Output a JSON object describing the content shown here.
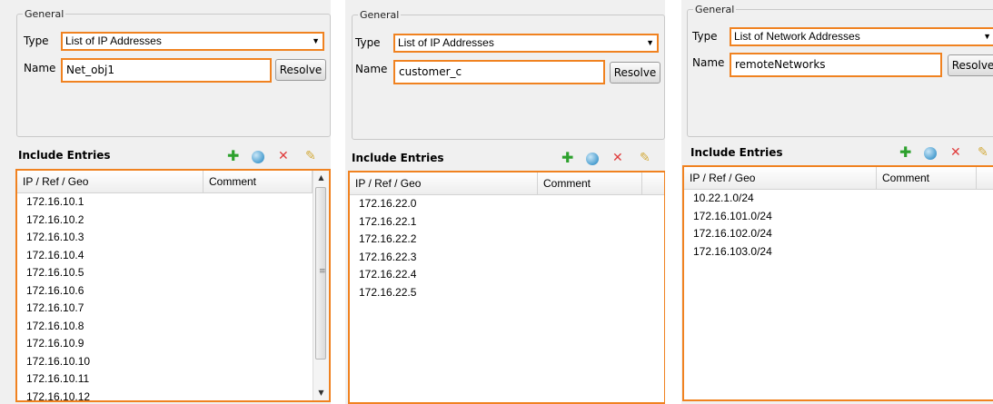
{
  "labels": {
    "general": "General",
    "type": "Type",
    "name": "Name",
    "resolve": "Resolve",
    "include_entries": "Include Entries",
    "col_ip": "IP / Ref / Geo",
    "col_comment": "Comment"
  },
  "icons": {
    "add": "plus-icon",
    "globe": "globe-icon",
    "delete": "x-icon",
    "edit": "pencil-icon",
    "dropdown": "chevron-down-icon"
  },
  "colors": {
    "highlight": "#f08220",
    "panel_bg": "#f0f0f0",
    "add_icon": "#2da12d",
    "delete_icon": "#e03c3c"
  },
  "panels": [
    {
      "type_value": "List of IP Addresses",
      "name_value": "Net_obj1",
      "entries": [
        "172.16.10.1",
        "172.16.10.2",
        "172.16.10.3",
        "172.16.10.4",
        "172.16.10.5",
        "172.16.10.6",
        "172.16.10.7",
        "172.16.10.8",
        "172.16.10.9",
        "172.16.10.10",
        "172.16.10.11",
        "172.16.10.12"
      ]
    },
    {
      "type_value": "List of IP Addresses",
      "name_value": "customer_c",
      "entries": [
        "172.16.22.0",
        "172.16.22.1",
        "172.16.22.2",
        "172.16.22.3",
        "172.16.22.4",
        "172.16.22.5"
      ]
    },
    {
      "type_value": "List of Network Addresses",
      "name_value": "remoteNetworks",
      "entries": [
        "10.22.1.0/24",
        "172.16.101.0/24",
        "172.16.102.0/24",
        "172.16.103.0/24"
      ]
    }
  ]
}
